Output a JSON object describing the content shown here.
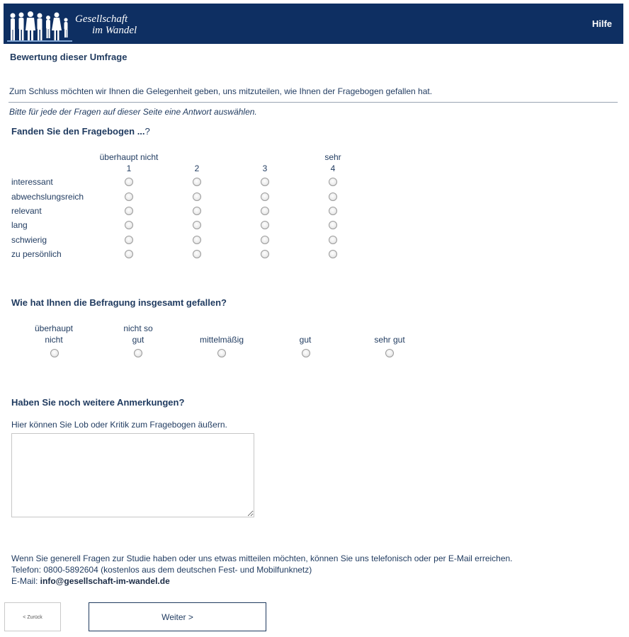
{
  "header": {
    "logo_line1": "Gesellschaft",
    "logo_line2": "im Wandel",
    "help_link": "Hilfe"
  },
  "page": {
    "title": "Bewertung dieser Umfrage",
    "intro": "Zum Schluss möchten wir Ihnen die Gelegenheit geben, uns mitzuteilen, wie Ihnen der Fragebogen gefallen hat.",
    "hint": "Bitte für jede der Fragen auf dieser Seite eine Antwort auswählen."
  },
  "matrix_question": {
    "title": "Fanden Sie den Fragebogen ...",
    "title_suffix": "?",
    "scale_labels": [
      "überhaupt nicht",
      "",
      "",
      "sehr"
    ],
    "scale_numbers": [
      "1",
      "2",
      "3",
      "4"
    ],
    "rows": [
      "interessant",
      "abwechslungsreich",
      "relevant",
      "lang",
      "schwierig",
      "zu persönlich"
    ]
  },
  "overall_question": {
    "title": "Wie hat Ihnen die Befragung insgesamt gefallen?",
    "options": [
      {
        "line1": "überhaupt",
        "line2": "nicht"
      },
      {
        "line1": "nicht so",
        "line2": "gut"
      },
      {
        "line1": "",
        "line2": "mittelmäßig"
      },
      {
        "line1": "",
        "line2": "gut"
      },
      {
        "line1": "",
        "line2": "sehr gut"
      }
    ]
  },
  "remarks_question": {
    "title": "Haben Sie noch weitere Anmerkungen?",
    "subtitle": "Hier können Sie Lob oder Kritik zum Fragebogen äußern.",
    "value": ""
  },
  "contact": {
    "line1": "Wenn Sie generell Fragen zur Studie haben oder uns etwas mitteilen möchten, können Sie uns telefonisch oder per E-Mail erreichen.",
    "line2": "Telefon: 0800-5892604 (kostenlos aus dem deutschen Fest- und Mobilfunknetz)",
    "email_label": "E-Mail: ",
    "email": "info@gesellschaft-im-wandel.de"
  },
  "navigation": {
    "back_label": "< Zurück",
    "next_label": "Weiter >"
  },
  "colors": {
    "header_bg": "#0e2f62",
    "text": "#1f3a5f"
  }
}
